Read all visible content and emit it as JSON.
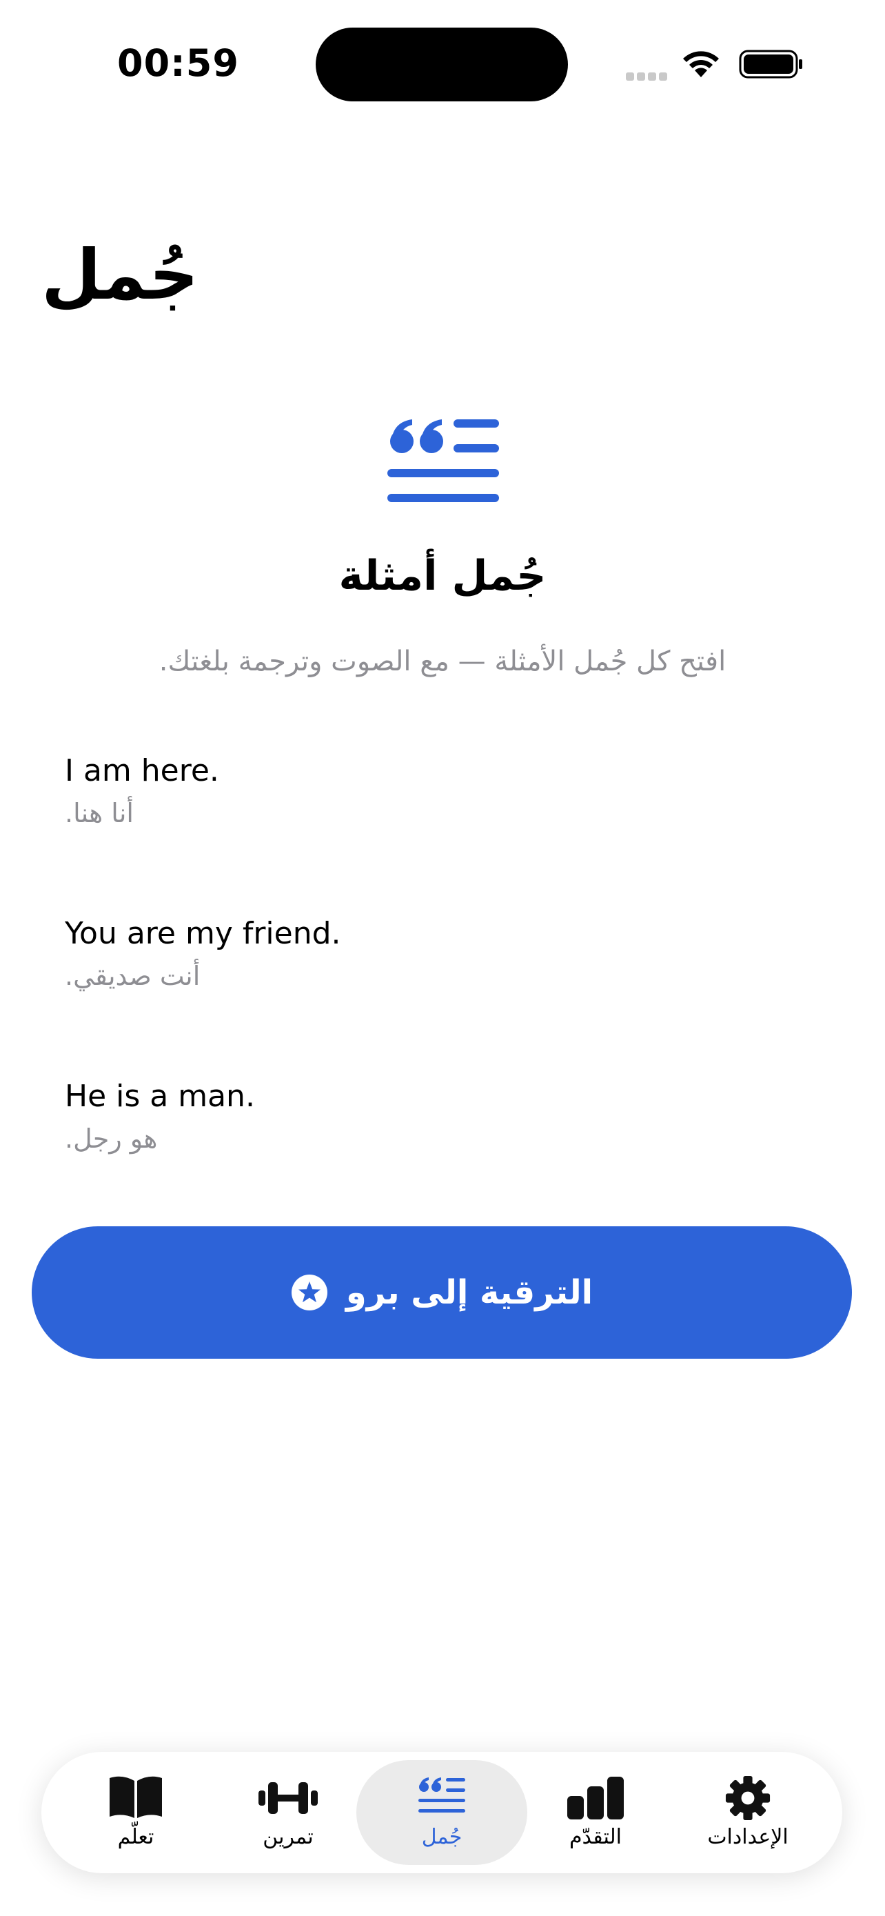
{
  "status_bar": {
    "time": "00:59"
  },
  "page": {
    "title": "جُمل"
  },
  "hero": {
    "icon": "quote-lines-icon",
    "title": "جُمل أمثلة",
    "subtitle": "افتح كل جُمل الأمثلة — مع الصوت وترجمة بلغتك."
  },
  "sentences": [
    {
      "en": "I am here.",
      "ar": "أنا هنا."
    },
    {
      "en": "You are my friend.",
      "ar": "أنت صديقي."
    },
    {
      "en": "He is a man.",
      "ar": "هو رجل."
    }
  ],
  "upgrade": {
    "label": "الترقية إلى برو",
    "icon": "star-circle-icon"
  },
  "tabs": [
    {
      "label": "تعلّم",
      "icon": "book-icon"
    },
    {
      "label": "تمرين",
      "icon": "dumbbell-icon"
    },
    {
      "label": "جُمل",
      "icon": "quote-lines-icon",
      "active": true
    },
    {
      "label": "التقدّم",
      "icon": "bar-chart-icon"
    },
    {
      "label": "الإعدادات",
      "icon": "gear-icon"
    }
  ],
  "colors": {
    "accent": "#2d63d8",
    "secondary_text": "#8e8e93",
    "tab_active_bg": "#ebebeb"
  }
}
